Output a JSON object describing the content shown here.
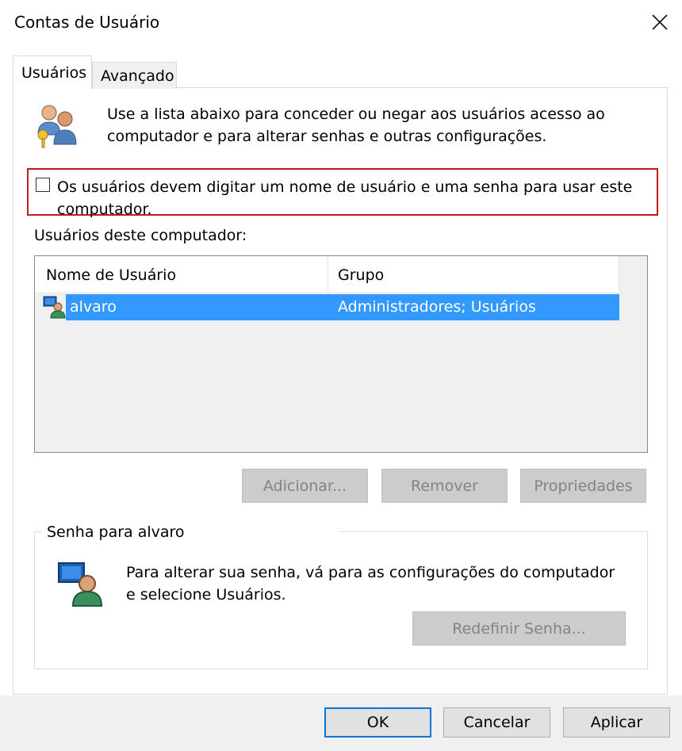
{
  "window": {
    "title": "Contas de Usuário",
    "close_icon": "close-icon"
  },
  "tabs": [
    {
      "label": "Usuários",
      "selected": true
    },
    {
      "label": "Avançado",
      "selected": false
    }
  ],
  "intro": {
    "icon": "users-keys-icon",
    "line1": "Use a lista abaixo para conceder ou negar aos usuários acesso ao",
    "line2": "computador e para alterar senhas e outras configurações."
  },
  "require_login": {
    "checked": false,
    "line1": "Os usuários devem digitar um nome de usuário e uma senha para usar este",
    "line2": "computador.",
    "highlight_color": "#c41a1a"
  },
  "users_section": {
    "label": "Usuários deste computador:",
    "columns": [
      "Nome de Usuário",
      "Grupo"
    ],
    "rows": [
      {
        "icon": "user-monitor-icon",
        "name": "alvaro",
        "group": "Administradores; Usuários",
        "selected": true
      }
    ],
    "selection_color": "#3399ff"
  },
  "list_buttons": {
    "add": "Adicionar...",
    "remove": "Remover",
    "properties": "Propriedades"
  },
  "password_group": {
    "title": "Senha para alvaro",
    "icon": "user-monitor-icon",
    "line1": "Para alterar sua senha, vá para as configurações do computador",
    "line2": "e selecione Usuários.",
    "reset_button": "Redefinir Senha..."
  },
  "footer": {
    "ok": "OK",
    "cancel": "Cancelar",
    "apply": "Aplicar"
  }
}
